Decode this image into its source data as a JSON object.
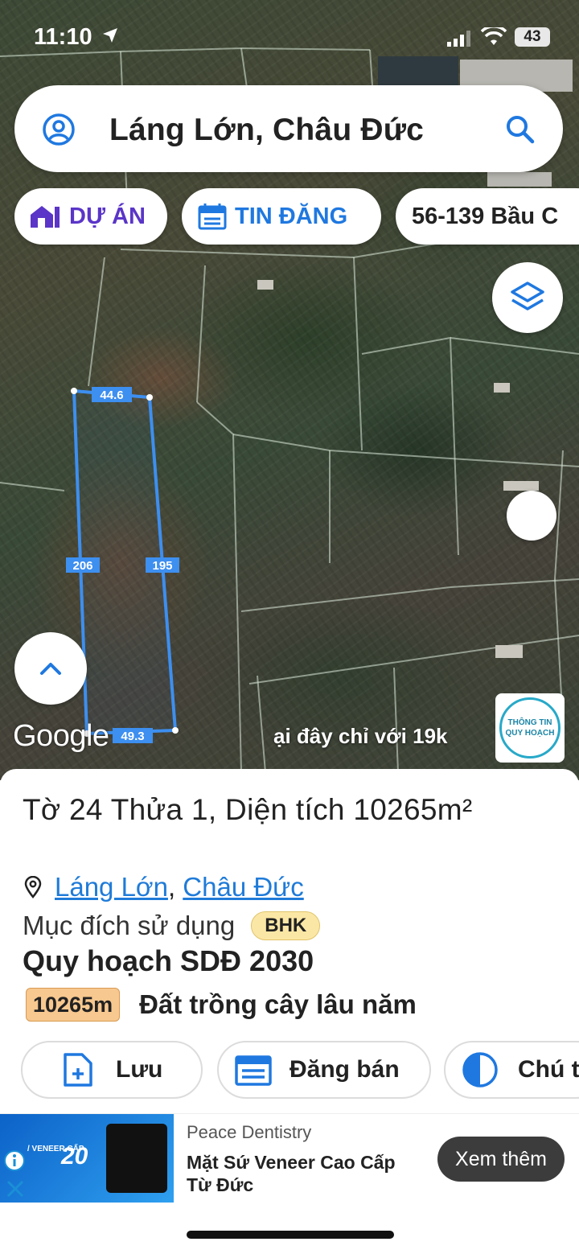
{
  "status_bar": {
    "time": "11:10",
    "battery": "43"
  },
  "search": {
    "query": "Láng Lớn, Châu Đức"
  },
  "chips": {
    "project": "DỰ ÁN",
    "listing": "TIN ĐĂNG",
    "address": "56-139 Bầu C"
  },
  "map": {
    "dimensions": {
      "top": "44.6",
      "left": "206",
      "right": "195",
      "bottom": "49.3"
    },
    "google_logo": "Google",
    "banner_text": "ại đây chỉ với 19k",
    "planning_badge": {
      "line1": "THÔNG TIN",
      "line2": "QUY HOẠCH"
    }
  },
  "parcel": {
    "title": "Tờ 24 Thửa 1, Diện tích 10265m²",
    "ward": "Láng Lớn",
    "separator": ",",
    "district": "Châu Đức",
    "usage_label": "Mục đích sử dụng",
    "usage_code": "BHK",
    "plan_title": "Quy hoạch SDĐ 2030",
    "plan_area": "10265m",
    "plan_desc": "Đất trồng cây lâu năm"
  },
  "actions": {
    "save": "Lưu",
    "sell": "Đăng bán",
    "note": "Chú t"
  },
  "ad": {
    "brand": "Peace Dentistry",
    "headline": "Mặt Sứ Veneer Cao Cấp Từ Đức",
    "cta": "Xem thêm",
    "discount": "20",
    "veneer": "/ VENEER\n CẤP"
  },
  "colors": {
    "parcel_line": "#3d8ff0",
    "project": "#5a35c8",
    "listing": "#1f78e0",
    "link": "#1f7bd8"
  }
}
